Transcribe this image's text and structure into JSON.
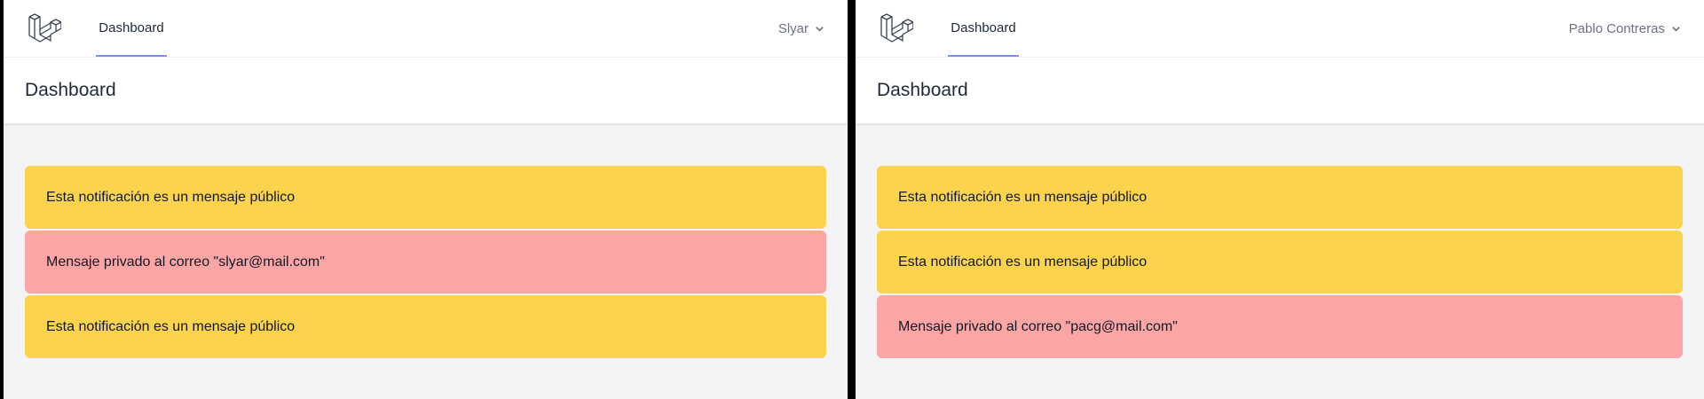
{
  "colors": {
    "public_alert": "#fcd34d",
    "private_alert": "#fca5a5",
    "nav_active_underline": "#818cf8",
    "page_background": "#f3f4f6"
  },
  "panes": [
    {
      "nav": {
        "logo_icon": "laravel-logo-icon",
        "link": "Dashboard",
        "user": "Slyar",
        "user_icon": "chevron-down-icon"
      },
      "header": {
        "title": "Dashboard"
      },
      "notifications": [
        {
          "type": "public",
          "text": "Esta notificación es un mensaje público"
        },
        {
          "type": "private",
          "text": "Mensaje privado al correo \"slyar@mail.com\""
        },
        {
          "type": "public",
          "text": "Esta notificación es un mensaje público"
        }
      ]
    },
    {
      "nav": {
        "logo_icon": "laravel-logo-icon",
        "link": "Dashboard",
        "user": "Pablo Contreras",
        "user_icon": "chevron-down-icon"
      },
      "header": {
        "title": "Dashboard"
      },
      "notifications": [
        {
          "type": "public",
          "text": "Esta notificación es un mensaje público"
        },
        {
          "type": "public",
          "text": "Esta notificación es un mensaje público"
        },
        {
          "type": "private",
          "text": "Mensaje privado al correo \"pacg@mail.com\""
        }
      ]
    }
  ]
}
